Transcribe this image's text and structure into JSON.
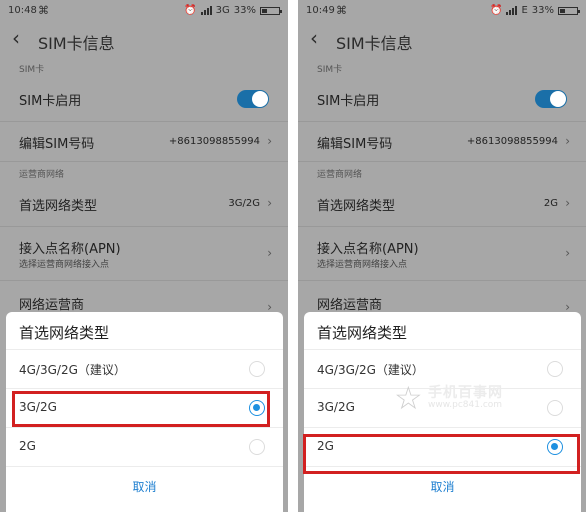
{
  "screens": [
    {
      "status": {
        "time": "10:48",
        "network": "3G",
        "battery": "33%",
        "battery_level": 0.33
      },
      "title": "SIM卡信息",
      "section_sim": "SIM卡",
      "sim_enable_label": "SIM卡启用",
      "sim_enable_on": true,
      "edit_sim_label": "编辑SIM号码",
      "sim_number": "+8613098855994",
      "section_carrier": "运营商网络",
      "pref_network_label": "首选网络类型",
      "pref_network_value": "3G/2G",
      "apn_label": "接入点名称(APN)",
      "apn_sub": "选择运营商网络接入点",
      "carrier_label": "网络运营商",
      "dialog": {
        "title": "首选网络类型",
        "options": [
          {
            "label": "4G/3G/2G（建议）",
            "selected": false
          },
          {
            "label": "3G/2G",
            "selected": true
          },
          {
            "label": "2G",
            "selected": false
          }
        ],
        "cancel": "取消"
      }
    },
    {
      "status": {
        "time": "10:49",
        "network": "E",
        "battery": "33%",
        "battery_level": 0.33
      },
      "title": "SIM卡信息",
      "section_sim": "SIM卡",
      "sim_enable_label": "SIM卡启用",
      "sim_enable_on": true,
      "edit_sim_label": "编辑SIM号码",
      "sim_number": "+8613098855994",
      "section_carrier": "运营商网络",
      "pref_network_label": "首选网络类型",
      "pref_network_value": "2G",
      "apn_label": "接入点名称(APN)",
      "apn_sub": "选择运营商网络接入点",
      "carrier_label": "网络运营商",
      "dialog": {
        "title": "首选网络类型",
        "options": [
          {
            "label": "4G/3G/2G（建议）",
            "selected": false
          },
          {
            "label": "3G/2G",
            "selected": false
          },
          {
            "label": "2G",
            "selected": true
          }
        ],
        "cancel": "取消"
      }
    }
  ],
  "watermark": {
    "name": "手机百事网",
    "url": "www.pc841.com"
  }
}
